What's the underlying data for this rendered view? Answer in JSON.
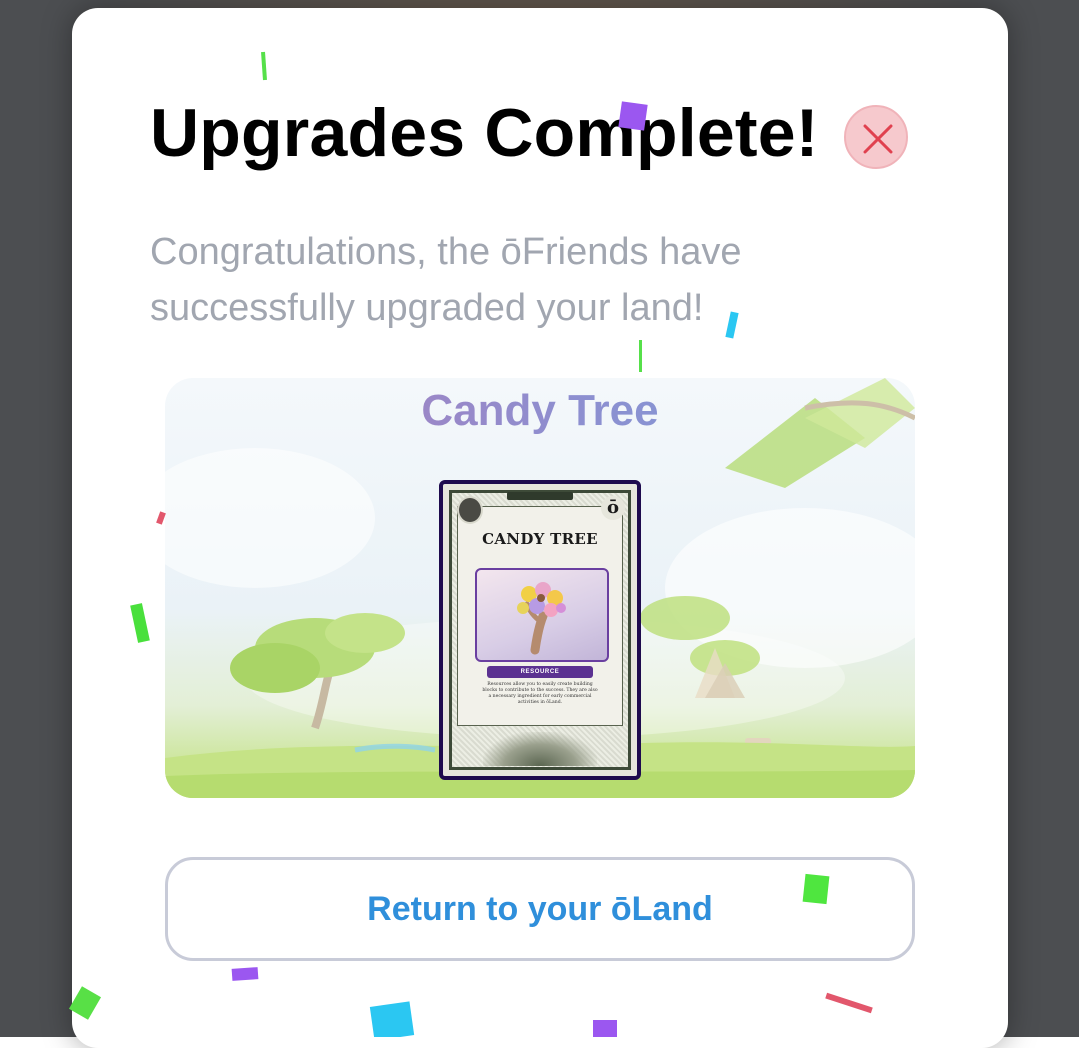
{
  "modal": {
    "title": "Upgrades Complete!",
    "close_label": "close",
    "subtitle": "Congratulations, the ōFriends have successfully upgraded your land!"
  },
  "reward": {
    "name": "Candy Tree",
    "card": {
      "title": "CANDY TREE",
      "type": "RESOURCE",
      "description": "Resources allow you to easily create building blocks to contribute to the success. They are also a necessary ingredient for early commercial activities in ōLand.",
      "corner_symbol": "ō"
    }
  },
  "actions": {
    "return_label": "Return to your ōLand"
  },
  "colors": {
    "title": "#000000",
    "subtitle": "#a1a6b0",
    "accent_blue": "#2f8fdb",
    "close_bg": "#f6c9cd",
    "close_x": "#e0414f",
    "card_border": "#1e0b4e",
    "card_type_bg": "#5b3191"
  },
  "icons": {
    "close": "close-x-icon"
  }
}
